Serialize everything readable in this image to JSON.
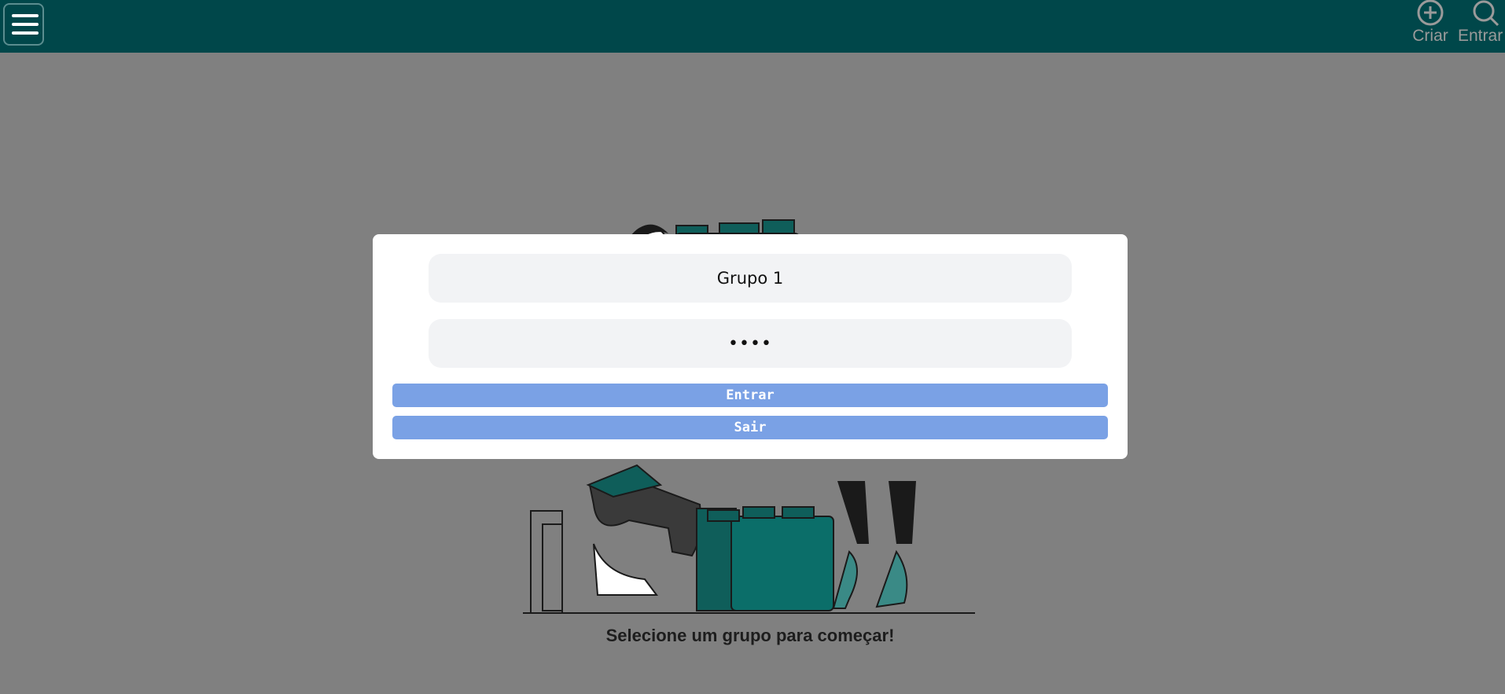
{
  "topbar": {
    "menu_icon": "hamburger-menu-icon",
    "actions": [
      {
        "label": "Criar",
        "icon": "plus-circle-icon"
      },
      {
        "label": "Entrar",
        "icon": "search-icon"
      }
    ],
    "color": "#00474a"
  },
  "main": {
    "caption": "Selecione um grupo para começar!",
    "illustration": "people-stacking-blocks-illustration"
  },
  "modal": {
    "group_value": "Grupo 1",
    "password_value": "••••",
    "enter_label": "Entrar",
    "exit_label": "Sair",
    "button_color": "#7aa1e5"
  }
}
